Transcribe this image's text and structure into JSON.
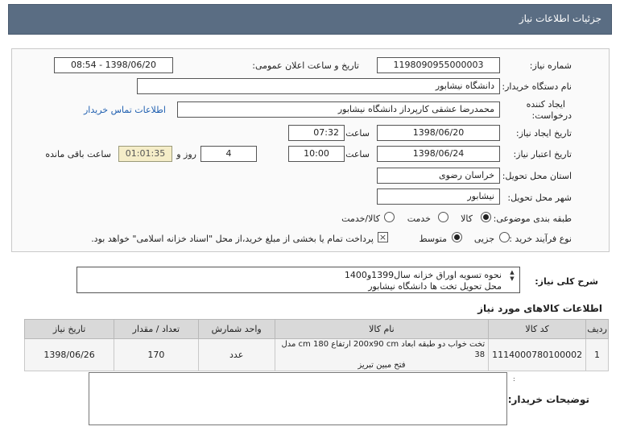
{
  "window": {
    "title": "جزئیات اطلاعات نیاز"
  },
  "form": {
    "need_number_label": "شماره نیاز:",
    "need_number": "1198090955000003",
    "announce_label": "تاریخ و ساعت اعلان عمومی:",
    "announce_value": "1398/06/20 - 08:54",
    "buyer_org_label": "نام دستگاه خریدار:",
    "buyer_org": "دانشگاه نیشابور",
    "creator_label_1": "ایجاد کننده",
    "creator_label_2": "درخواست:",
    "creator": "محمدرضا عشقی کارپرداز دانشگاه نیشابور",
    "contact_link": "اطلاعات تماس خریدار",
    "create_date_label": "تاریخ ایجاد نیاز:",
    "create_date": "1398/06/20",
    "time_label": "ساعت",
    "create_time": "07:32",
    "valid_date_label": "تاریخ اعتبار نیاز:",
    "valid_date": "1398/06/24",
    "valid_time": "10:00",
    "days_value": "4",
    "days_label": "روز و",
    "remaining_time": "01:01:35",
    "remaining_label": "ساعت باقی مانده",
    "province_label": "استان محل تحویل:",
    "province": "خراسان رضوی",
    "city_label": "شهر محل تحویل:",
    "city": "نیشابور",
    "category_label": "طبقه بندی موضوعی:",
    "category_options": [
      "کالا",
      "خدمت",
      "کالا/خدمت"
    ],
    "category_selected": "کالا",
    "purchase_label": "نوع فرآیند خرید :",
    "purchase_options": [
      "جزیی",
      "متوسط"
    ],
    "purchase_selected": "متوسط",
    "payment_note": "پرداخت تمام یا بخشی از مبلغ خرید،از محل \"اسناد خزانه اسلامی\" خواهد بود."
  },
  "description": {
    "label": "شرح کلی نیاز:",
    "line1": "نحوه تسویه اوراق خزانه سال1399و1400",
    "line2": "محل تحویل تخت ها دانشگاه نیشابور"
  },
  "goods": {
    "title": "اطلاعات کالاهای مورد نیاز",
    "columns": [
      "ردیف",
      "کد کالا",
      "نام کالا",
      "واحد شمارش",
      "تعداد / مقدار",
      "تاریخ نیاز"
    ],
    "rows": [
      {
        "index": "1",
        "code": "1114000780100002",
        "name_line1": "تخت خواب دو طبقه ابعاد 200x90 cm ارتفاع 180 cm مدل 38",
        "name_line2": "فتح مبین تبریز",
        "unit": "عدد",
        "quantity": "170",
        "date": "1398/06/26"
      }
    ]
  },
  "buyer_notes": {
    "label": "توضیحات خریدار:",
    "value": ""
  }
}
